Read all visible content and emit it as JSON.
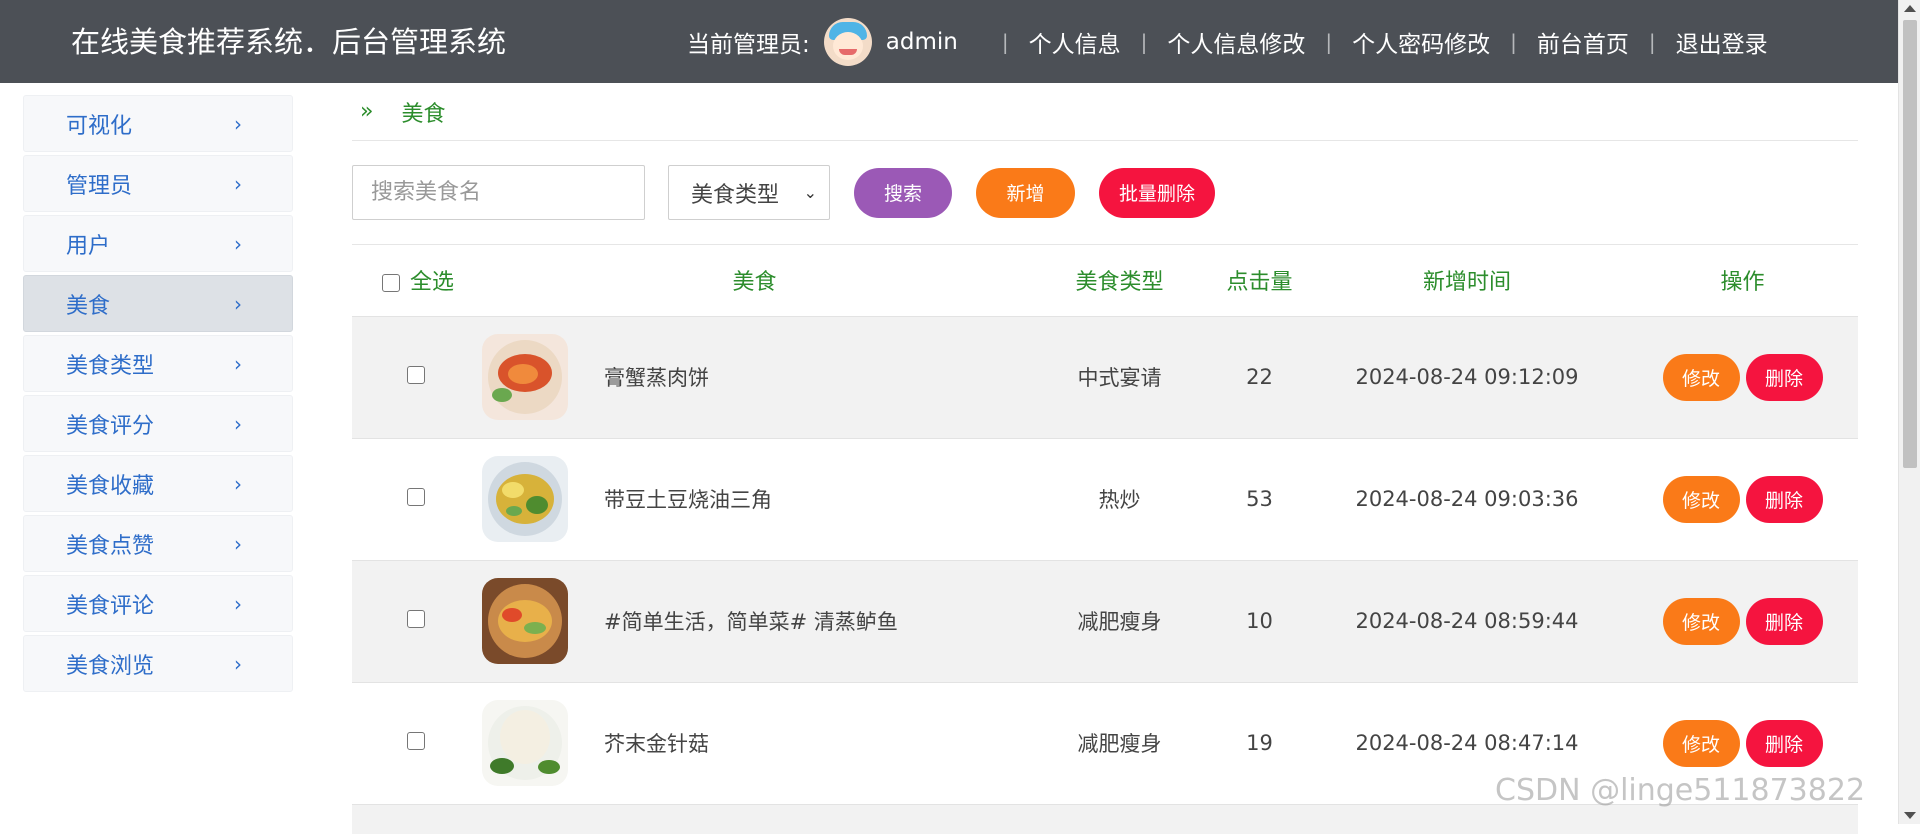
{
  "header": {
    "title": "在线美食推荐系统．后台管理系统",
    "admin_label": "当前管理员:",
    "admin_name": "admin",
    "links": [
      "个人信息",
      "个人信息修改",
      "个人密码修改",
      "前台首页",
      "退出登录"
    ],
    "separator": "|"
  },
  "sidebar": {
    "items": [
      {
        "label": "可视化"
      },
      {
        "label": "管理员"
      },
      {
        "label": "用户"
      },
      {
        "label": "美食"
      },
      {
        "label": "美食类型"
      },
      {
        "label": "美食评分"
      },
      {
        "label": "美食收藏"
      },
      {
        "label": "美食点赞"
      },
      {
        "label": "美食评论"
      },
      {
        "label": "美食浏览"
      }
    ],
    "active_index": 3,
    "chevron": "›"
  },
  "breadcrumb": {
    "icon": "»",
    "current": "美食"
  },
  "toolbar": {
    "search_placeholder": "搜索美食名",
    "type_select_value": "美食类型",
    "search_label": "搜索",
    "add_label": "新增",
    "batch_delete_label": "批量删除"
  },
  "table": {
    "headers": {
      "select_all": "全选",
      "food": "美食",
      "type": "美食类型",
      "clicks": "点击量",
      "time": "新增时间",
      "ops": "操作"
    },
    "rows": [
      {
        "name": "膏蟹蒸肉饼",
        "type": "中式宴请",
        "clicks": "22",
        "time": "2024-08-24 09:12:09",
        "image": "crab-dish-image"
      },
      {
        "name": "带豆土豆烧油三角",
        "type": "热炒",
        "clicks": "53",
        "time": "2024-08-24 09:03:36",
        "image": "potato-beans-image"
      },
      {
        "name": "#简单生活，简单菜# 清蒸鲈鱼",
        "type": "减肥瘦身",
        "clicks": "10",
        "time": "2024-08-24 08:59:44",
        "image": "steamed-fish-image"
      },
      {
        "name": "芥末金针菇",
        "type": "减肥瘦身",
        "clicks": "19",
        "time": "2024-08-24 08:47:14",
        "image": "enoki-mushroom-image"
      }
    ],
    "edit_label": "修改",
    "delete_label": "删除"
  },
  "watermark": "CSDN @linge511873822",
  "colors": {
    "header_bg": "#4c5056",
    "accent_green": "#2c8d2c",
    "link_blue": "#2e6dc9",
    "btn_purple": "#9b59b6",
    "btn_orange": "#fa7a18",
    "btn_red": "#f5143f"
  }
}
